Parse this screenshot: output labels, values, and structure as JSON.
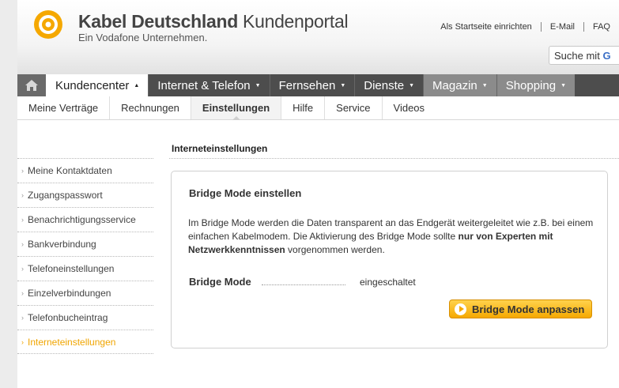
{
  "header": {
    "brand_name_bold": "Kabel Deutschland",
    "brand_name_regular": "Kundenportal",
    "brand_subtitle": "Ein Vodafone Unternehmen.",
    "toplinks": [
      "Als Startseite einrichten",
      "E-Mail",
      "FAQ"
    ],
    "search_placeholder": "Suche mit",
    "search_provider_initial": "G"
  },
  "main_nav": {
    "home_icon": "home-icon",
    "tabs": [
      {
        "label": "Kundencenter",
        "caret": "▲"
      },
      {
        "label": "Internet & Telefon",
        "caret": "▼"
      },
      {
        "label": "Fernsehen",
        "caret": "▼"
      },
      {
        "label": "Dienste",
        "caret": "▼"
      },
      {
        "label": "Magazin",
        "caret": "▼"
      },
      {
        "label": "Shopping",
        "caret": "▼"
      }
    ]
  },
  "sub_nav": {
    "tabs": [
      "Meine Verträge",
      "Rechnungen",
      "Einstellungen",
      "Hilfe",
      "Service",
      "Videos"
    ],
    "active": "Einstellungen"
  },
  "sidebar": {
    "items": [
      "Meine Kontaktdaten",
      "Zugangspasswort",
      "Benachrichtigungsservice",
      "Bankverbindung",
      "Telefoneinstellungen",
      "Einzelverbindungen",
      "Telefonbucheintrag",
      "Interneteinstellungen"
    ],
    "active": "Interneteinstellungen"
  },
  "content": {
    "title": "Interneteinstellungen",
    "panel": {
      "title": "Bridge Mode einstellen",
      "text_part1": "Im Bridge Mode werden die Daten transparent an das Endgerät weitergeleitet wie z.B. bei einem einfachen Kabelmodem. Die Aktivierung des Bridge Mode sollte ",
      "text_bold": "nur von Experten mit Netzwerkkenntnissen",
      "text_part2": " vorgenommen werden.",
      "field_label": "Bridge Mode",
      "field_value": "eingeschaltet",
      "button_label": "Bridge Mode anpassen"
    }
  },
  "colors": {
    "brand_orange": "#f5a800",
    "nav_dark": "#4d4d4d",
    "active_sidebar": "#f0a500"
  }
}
